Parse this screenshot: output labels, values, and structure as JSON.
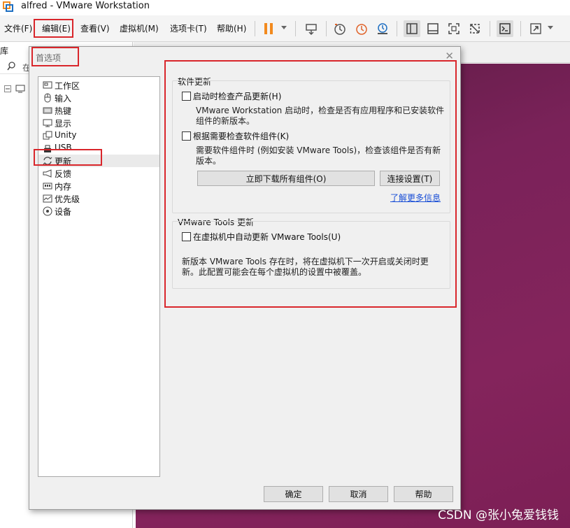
{
  "window": {
    "title": "alfred - VMware Workstation"
  },
  "menu": [
    {
      "label": "文件(F)"
    },
    {
      "label": "编辑(E)"
    },
    {
      "label": "查看(V)"
    },
    {
      "label": "虚拟机(M)"
    },
    {
      "label": "选项卡(T)"
    },
    {
      "label": "帮助(H)"
    }
  ],
  "toolbar": {
    "icons": [
      "pause-icon",
      "send-keys-icon",
      "snapshot-icon",
      "revert-snapshot-icon",
      "manage-snapshots-icon",
      "library-view-icon",
      "thumbnail-view-icon",
      "fullscreen-icon",
      "unity-icon",
      "console-icon",
      "stretch-icon"
    ]
  },
  "library": {
    "title": "库",
    "search_placeholder": "在"
  },
  "dialog": {
    "title": "首选项",
    "nav": [
      {
        "label": "工作区",
        "icon": "workspace-icon"
      },
      {
        "label": "输入",
        "icon": "mouse-icon"
      },
      {
        "label": "热键",
        "icon": "keyboard-icon"
      },
      {
        "label": "显示",
        "icon": "monitor-icon"
      },
      {
        "label": "Unity",
        "icon": "unity-icon"
      },
      {
        "label": "USB",
        "icon": "usb-icon"
      },
      {
        "label": "更新",
        "icon": "refresh-icon",
        "selected": true
      },
      {
        "label": "反馈",
        "icon": "megaphone-icon"
      },
      {
        "label": "内存",
        "icon": "memory-icon"
      },
      {
        "label": "优先级",
        "icon": "priority-icon"
      },
      {
        "label": "设备",
        "icon": "device-icon"
      }
    ],
    "software_update": {
      "title": "软件更新",
      "check_product": {
        "label": "启动时检查产品更新(H)",
        "checked": false
      },
      "check_product_desc_1": "VMware Workstation 启动时，检查是否有应用程序和已安装软件",
      "check_product_desc_2": "组件的新版本。",
      "check_components": {
        "label": "根据需要检查软件组件(K)",
        "checked": false
      },
      "check_components_desc_1": "需要软件组件时 (例如安装 VMware Tools)，检查该组件是否有新",
      "check_components_desc_2": "版本。",
      "download_all_button": "立即下载所有组件(O)",
      "connection_settings_button": "连接设置(T)",
      "learn_more_link": "了解更多信息"
    },
    "tools_update": {
      "title": "VMware Tools 更新",
      "auto_update": {
        "label": "在虚拟机中自动更新 VMware Tools(U)",
        "checked": false
      },
      "desc_1": "新版本 VMware Tools 存在时，将在虚拟机下一次开启或关闭时更",
      "desc_2": "新。此配置可能会在每个虚拟机的设置中被覆盖。"
    },
    "buttons": {
      "ok": "确定",
      "cancel": "取消",
      "help": "帮助"
    }
  },
  "watermark": "CSDN @张小兔爱钱钱",
  "colors": {
    "highlight_box": "#d9262b",
    "pause_orange": "#f28a1e",
    "vm_background": "#7a2259",
    "link": "#1a4fd6"
  }
}
